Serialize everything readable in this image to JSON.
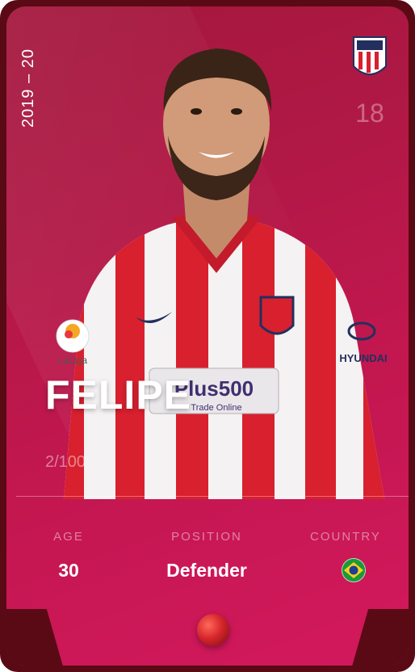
{
  "card": {
    "season": "2019 – 20",
    "jersey_number": "18",
    "player_name": "FELIPE",
    "serial": "2/100",
    "sponsor_text": "Plus500",
    "sponsor_sub": "Trade Online",
    "kit_sponsor": "HYUNDAI",
    "league_patch": "LaLiga"
  },
  "stats": {
    "age": {
      "label": "AGE",
      "value": "30"
    },
    "position": {
      "label": "POSITION",
      "value": "Defender"
    },
    "country": {
      "label": "COUNTRY",
      "flag": "brazil-flag-icon"
    }
  },
  "colors": {
    "card_primary": "#b01845",
    "card_frame": "#5a0a14",
    "jersey_red": "#d8202f",
    "rarity": "#d7262c"
  },
  "icons": [
    "club-badge-icon",
    "brazil-flag-icon",
    "rarity-orb-icon"
  ]
}
